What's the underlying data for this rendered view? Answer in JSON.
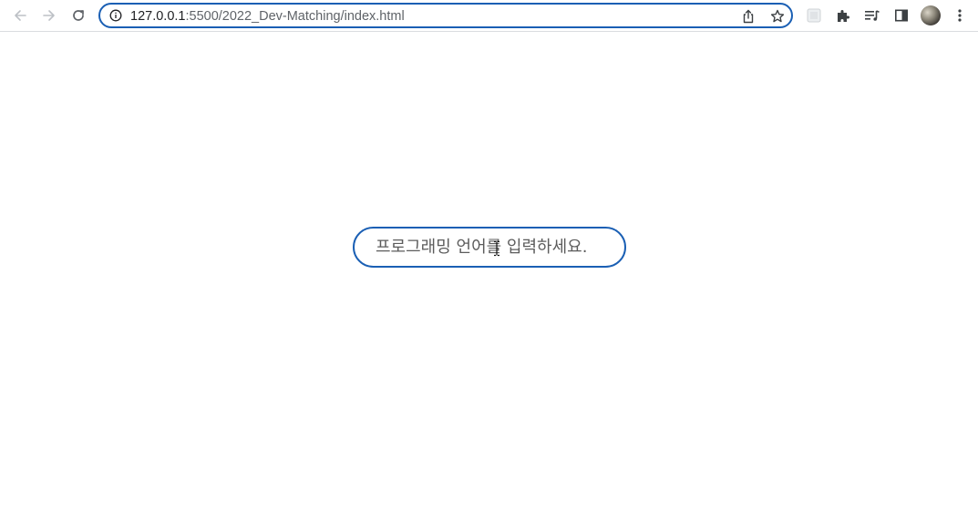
{
  "browser": {
    "url_host": "127.0.0.1",
    "url_rest": ":5500/2022_Dev-Matching/index.html",
    "icons": {
      "back": "arrow-left-icon",
      "forward": "arrow-right-icon",
      "reload": "reload-icon",
      "site_info": "info-icon",
      "share": "share-icon",
      "bookmark": "star-icon",
      "extension_placeholder": "extension-tile-icon",
      "extensions": "puzzle-icon",
      "media": "media-queue-icon",
      "side_panel": "side-panel-icon",
      "menu": "kebab-menu-icon"
    }
  },
  "search": {
    "placeholder": "프로그래밍 언어를 입력하세요.",
    "value": ""
  },
  "colors": {
    "accent": "#1a5fb4"
  }
}
